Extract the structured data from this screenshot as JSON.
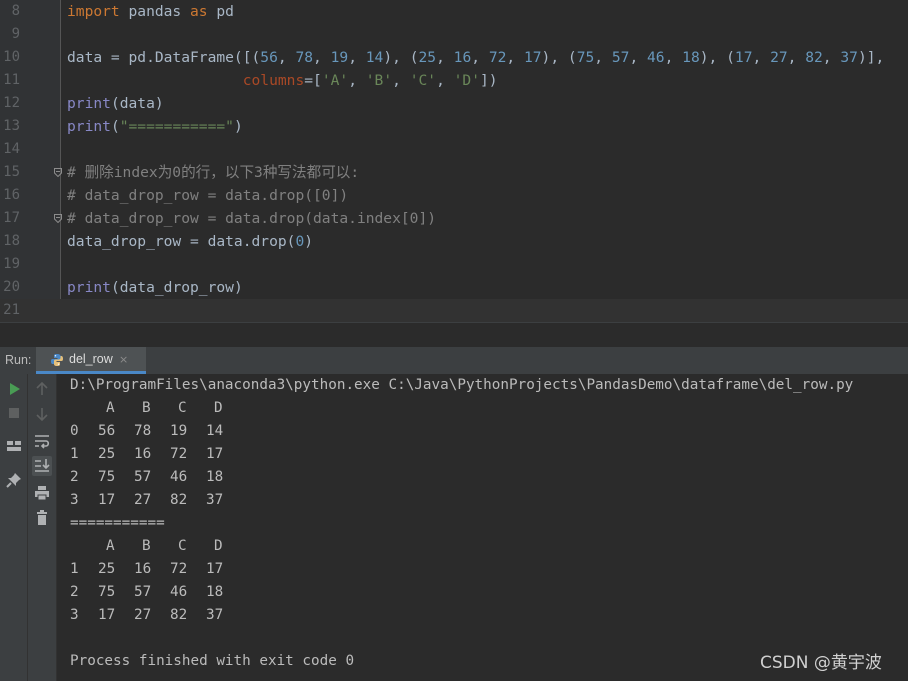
{
  "editor": {
    "lines": [
      {
        "n": "8",
        "html": "<span class=\"kw\">import</span> pandas <span class=\"kw\">as</span> pd"
      },
      {
        "n": "9",
        "html": ""
      },
      {
        "n": "10",
        "html": "data = pd.DataFrame([(<span class=\"num\">56</span>, <span class=\"num\">78</span>, <span class=\"num\">19</span>, <span class=\"num\">14</span>), (<span class=\"num\">25</span>, <span class=\"num\">16</span>, <span class=\"num\">72</span>, <span class=\"num\">17</span>), (<span class=\"num\">75</span>, <span class=\"num\">57</span>, <span class=\"num\">46</span>, <span class=\"num\">18</span>), (<span class=\"num\">17</span>, <span class=\"num\">27</span>, <span class=\"num\">82</span>, <span class=\"num\">37</span>)],"
      },
      {
        "n": "11",
        "html": "                    <span class=\"param\">columns</span>=[<span class=\"str\">'A'</span>, <span class=\"str\">'B'</span>, <span class=\"str\">'C'</span>, <span class=\"str\">'D'</span>])"
      },
      {
        "n": "12",
        "html": "<span class=\"builtin\">print</span>(data)"
      },
      {
        "n": "13",
        "html": "<span class=\"builtin\">print</span>(<span class=\"str\">\"===========\"</span>)"
      },
      {
        "n": "14",
        "html": ""
      },
      {
        "n": "15",
        "html": "<span class=\"cmt\"># 删除index为0的行，以下3种写法都可以:</span>"
      },
      {
        "n": "16",
        "html": "<span class=\"cmt\"># data_drop_row = data.drop([0])</span>"
      },
      {
        "n": "17",
        "html": "<span class=\"cmt\"># data_drop_row = data.drop(data.index[0])</span>"
      },
      {
        "n": "18",
        "html": "data_drop_row = data.drop(<span class=\"num\">0</span>)"
      },
      {
        "n": "19",
        "html": ""
      },
      {
        "n": "20",
        "html": "<span class=\"builtin\">print</span>(data_drop_row)"
      },
      {
        "n": "21",
        "html": ""
      }
    ],
    "current_line": "21",
    "fold_lines": [
      "15",
      "17"
    ]
  },
  "run": {
    "label": "Run:",
    "tab_label": "del_row",
    "tab_close": "×"
  },
  "console": {
    "command": "D:\\ProgramFiles\\anaconda3\\python.exe C:\\Java\\PythonProjects\\PandasDemo\\dataframe\\del_row.py",
    "table1": {
      "header": [
        "A",
        "B",
        "C",
        "D"
      ],
      "rows": [
        {
          "index": "0",
          "cells": [
            "56",
            "78",
            "19",
            "14"
          ]
        },
        {
          "index": "1",
          "cells": [
            "25",
            "16",
            "72",
            "17"
          ]
        },
        {
          "index": "2",
          "cells": [
            "75",
            "57",
            "46",
            "18"
          ]
        },
        {
          "index": "3",
          "cells": [
            "17",
            "27",
            "82",
            "37"
          ]
        }
      ]
    },
    "separator": "===========",
    "table2": {
      "header": [
        "A",
        "B",
        "C",
        "D"
      ],
      "rows": [
        {
          "index": "1",
          "cells": [
            "25",
            "16",
            "72",
            "17"
          ]
        },
        {
          "index": "2",
          "cells": [
            "75",
            "57",
            "46",
            "18"
          ]
        },
        {
          "index": "3",
          "cells": [
            "17",
            "27",
            "82",
            "37"
          ]
        }
      ]
    },
    "exit_message": "Process finished with exit code 0"
  },
  "watermark": "CSDN @黄宇波",
  "colors": {
    "keyword": "#cc7832",
    "number": "#6897bb",
    "string": "#6a8759",
    "builtin": "#8888c6",
    "comment": "#808080",
    "accent": "#4a88c7"
  },
  "icons": {
    "run_left": [
      "rerun-icon",
      "stop-icon",
      "layout-icon",
      "pin-icon"
    ],
    "run_right": [
      "up-arrow-icon",
      "down-arrow-icon",
      "soft-wrap-icon",
      "scroll-to-end-icon",
      "print-icon",
      "trash-icon"
    ]
  }
}
